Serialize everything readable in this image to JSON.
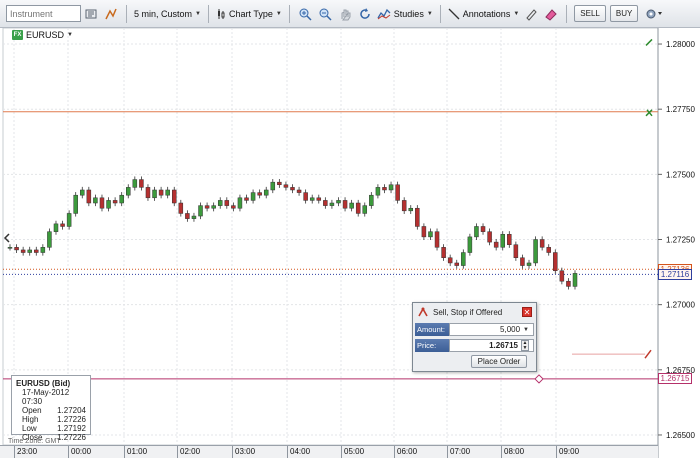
{
  "toolbar": {
    "instrument_placeholder": "Instrument",
    "period_label": "5 min, Custom",
    "chart_type_label": "Chart Type",
    "studies_label": "Studies",
    "annotations_label": "Annotations",
    "sell_label": "SELL",
    "buy_label": "BUY"
  },
  "symbol": {
    "badge": "FX",
    "name": "EURUSD"
  },
  "price_axis": {
    "ticks": [
      "1.28000",
      "1.27750",
      "1.27500",
      "1.27250",
      "1.27000",
      "1.26750",
      "1.26500"
    ],
    "tags": [
      {
        "value": "1.27136",
        "color": "#d4541c"
      },
      {
        "value": "1.27116",
        "color": "#2e3f9e"
      },
      {
        "value": "1.26715",
        "color": "#b5306a"
      }
    ]
  },
  "time_axis": {
    "ticks": [
      "23:00",
      "00:00",
      "01:00",
      "02:00",
      "03:00",
      "04:00",
      "05:00",
      "06:00",
      "07:00",
      "08:00",
      "09:00"
    ]
  },
  "ohlc": {
    "title": "EURUSD (Bid)",
    "datetime": "17-May-2012 07:30",
    "rows": [
      {
        "label": "Open",
        "value": "1.27204"
      },
      {
        "label": "High",
        "value": "1.27226"
      },
      {
        "label": "Low",
        "value": "1.27192"
      },
      {
        "label": "Close",
        "value": "1.27226"
      }
    ]
  },
  "timezone": "Time Zone: GMT",
  "order": {
    "title": "Sell, Stop if Offered",
    "amount_label": "Amount:",
    "amount_value": "5,000",
    "price_label": "Price:",
    "price_value": "1.26715",
    "place_label": "Place Order"
  },
  "chart_data": {
    "type": "candlestick",
    "symbol": "EURUSD",
    "interval": "5 min",
    "ylim": [
      1.2645,
      1.2805
    ],
    "x_ticks": [
      "23:00",
      "00:00",
      "01:00",
      "02:00",
      "03:00",
      "04:00",
      "05:00",
      "06:00",
      "07:00",
      "08:00",
      "09:00"
    ],
    "levels": [
      {
        "price": 1.2774,
        "color": "#e07a4f",
        "style": "solid"
      },
      {
        "price": 1.27136,
        "color": "#d4541c",
        "style": "dotted"
      },
      {
        "price": 1.27116,
        "color": "#2e3f9e",
        "style": "dotted"
      },
      {
        "price": 1.26715,
        "color": "#b5306a",
        "style": "solid"
      }
    ],
    "close_series": [
      1.2722,
      1.2721,
      1.272,
      1.2721,
      1.272,
      1.2722,
      1.2728,
      1.2731,
      1.273,
      1.2735,
      1.2742,
      1.2744,
      1.2739,
      1.2741,
      1.2737,
      1.274,
      1.2739,
      1.2742,
      1.2745,
      1.2748,
      1.2745,
      1.2741,
      1.2744,
      1.2742,
      1.2744,
      1.2739,
      1.2735,
      1.2733,
      1.2734,
      1.2738,
      1.2737,
      1.2738,
      1.274,
      1.2738,
      1.2737,
      1.2741,
      1.274,
      1.2743,
      1.2742,
      1.2744,
      1.2747,
      1.2746,
      1.2745,
      1.2744,
      1.2743,
      1.274,
      1.2741,
      1.274,
      1.2738,
      1.2739,
      1.274,
      1.2737,
      1.2739,
      1.2735,
      1.2738,
      1.2742,
      1.2745,
      1.2744,
      1.2746,
      1.274,
      1.2736,
      1.2737,
      1.273,
      1.2726,
      1.2728,
      1.2722,
      1.2718,
      1.2716,
      1.2715,
      1.272,
      1.2726,
      1.273,
      1.2728,
      1.2724,
      1.2722,
      1.2727,
      1.2723,
      1.2718,
      1.2715,
      1.2716,
      1.2725,
      1.2722,
      1.272,
      1.2713,
      1.2709,
      1.2707,
      1.2712
    ]
  }
}
